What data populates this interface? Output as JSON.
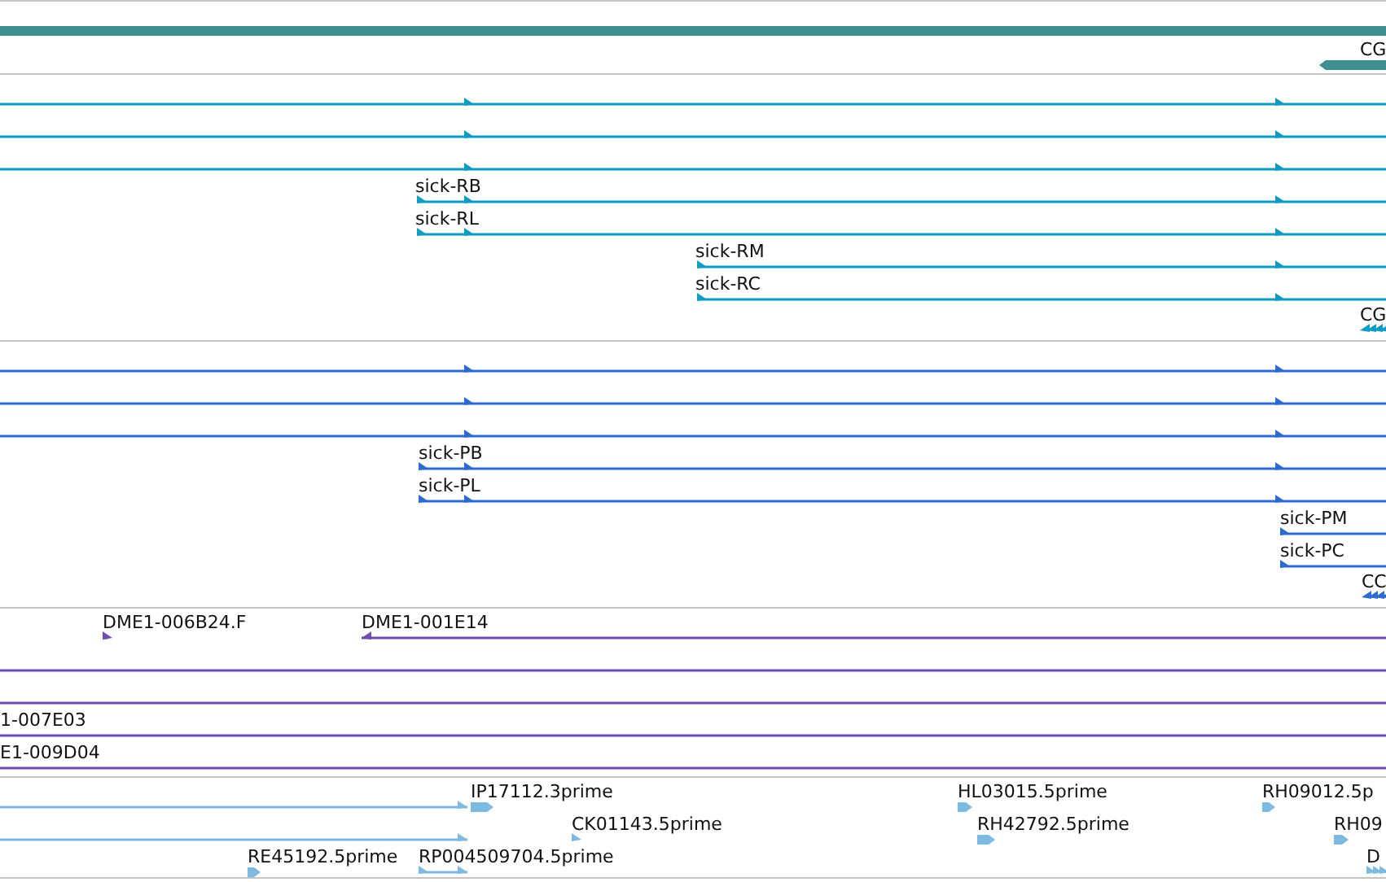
{
  "tracks": [
    {
      "color": "#3f8f91",
      "features": [
        {
          "kind": "bar"
        },
        {
          "kind": "block",
          "label": "CG",
          "reverse": true
        }
      ]
    },
    {
      "color": "#0f9bc2",
      "features": [
        {
          "kind": "transcript",
          "reverse": false
        },
        {
          "kind": "transcript",
          "reverse": false
        },
        {
          "kind": "transcript",
          "reverse": false
        },
        {
          "kind": "transcript",
          "label": "sick-RB",
          "reverse": false
        },
        {
          "kind": "transcript",
          "label": "sick-RL",
          "reverse": false
        },
        {
          "kind": "transcript",
          "label": "sick-RM",
          "reverse": false
        },
        {
          "kind": "transcript",
          "label": "sick-RC",
          "reverse": false
        },
        {
          "kind": "cluster",
          "label": "CG",
          "reverse": true
        }
      ]
    },
    {
      "color": "#2d6bd0",
      "features": [
        {
          "kind": "transcript",
          "reverse": false
        },
        {
          "kind": "transcript",
          "reverse": false
        },
        {
          "kind": "transcript",
          "reverse": false
        },
        {
          "kind": "transcript",
          "label": "sick-PB",
          "reverse": false
        },
        {
          "kind": "transcript",
          "label": "sick-PL",
          "reverse": false
        },
        {
          "kind": "transcript",
          "label": "sick-PM",
          "reverse": false
        },
        {
          "kind": "transcript",
          "label": "sick-PC",
          "reverse": false
        },
        {
          "kind": "cluster",
          "label": "CC",
          "reverse": true
        }
      ]
    },
    {
      "color": "#6c4fb0",
      "features": [
        {
          "kind": "transcript",
          "label": "DME1-006B24.F",
          "reverse": false
        },
        {
          "kind": "transcript",
          "label": "DME1-001E14",
          "reverse": true
        },
        {
          "kind": "transcript"
        },
        {
          "kind": "transcript"
        },
        {
          "kind": "transcript",
          "label": "1-007E03"
        },
        {
          "kind": "transcript",
          "label": "E1-009D04"
        }
      ]
    },
    {
      "color": "#7db9e0",
      "features": [
        {
          "kind": "transcript",
          "reverse": false
        },
        {
          "kind": "block",
          "label": "IP17112.3prime",
          "reverse": false
        },
        {
          "kind": "block",
          "label": "HL03015.5prime",
          "reverse": false
        },
        {
          "kind": "block",
          "label": "RH09012.5p",
          "reverse": false
        },
        {
          "kind": "transcript",
          "reverse": false
        },
        {
          "kind": "transcript",
          "label": "CK01143.5prime",
          "reverse": false
        },
        {
          "kind": "block",
          "label": "RH42792.5prime",
          "reverse": false
        },
        {
          "kind": "block",
          "label": "RH09",
          "reverse": false
        },
        {
          "kind": "block",
          "label": "RE45192.5prime",
          "reverse": false
        },
        {
          "kind": "transcript",
          "label": "RP004509704.5prime",
          "reverse": false
        },
        {
          "kind": "cluster",
          "label": "D",
          "reverse": false
        }
      ]
    }
  ]
}
